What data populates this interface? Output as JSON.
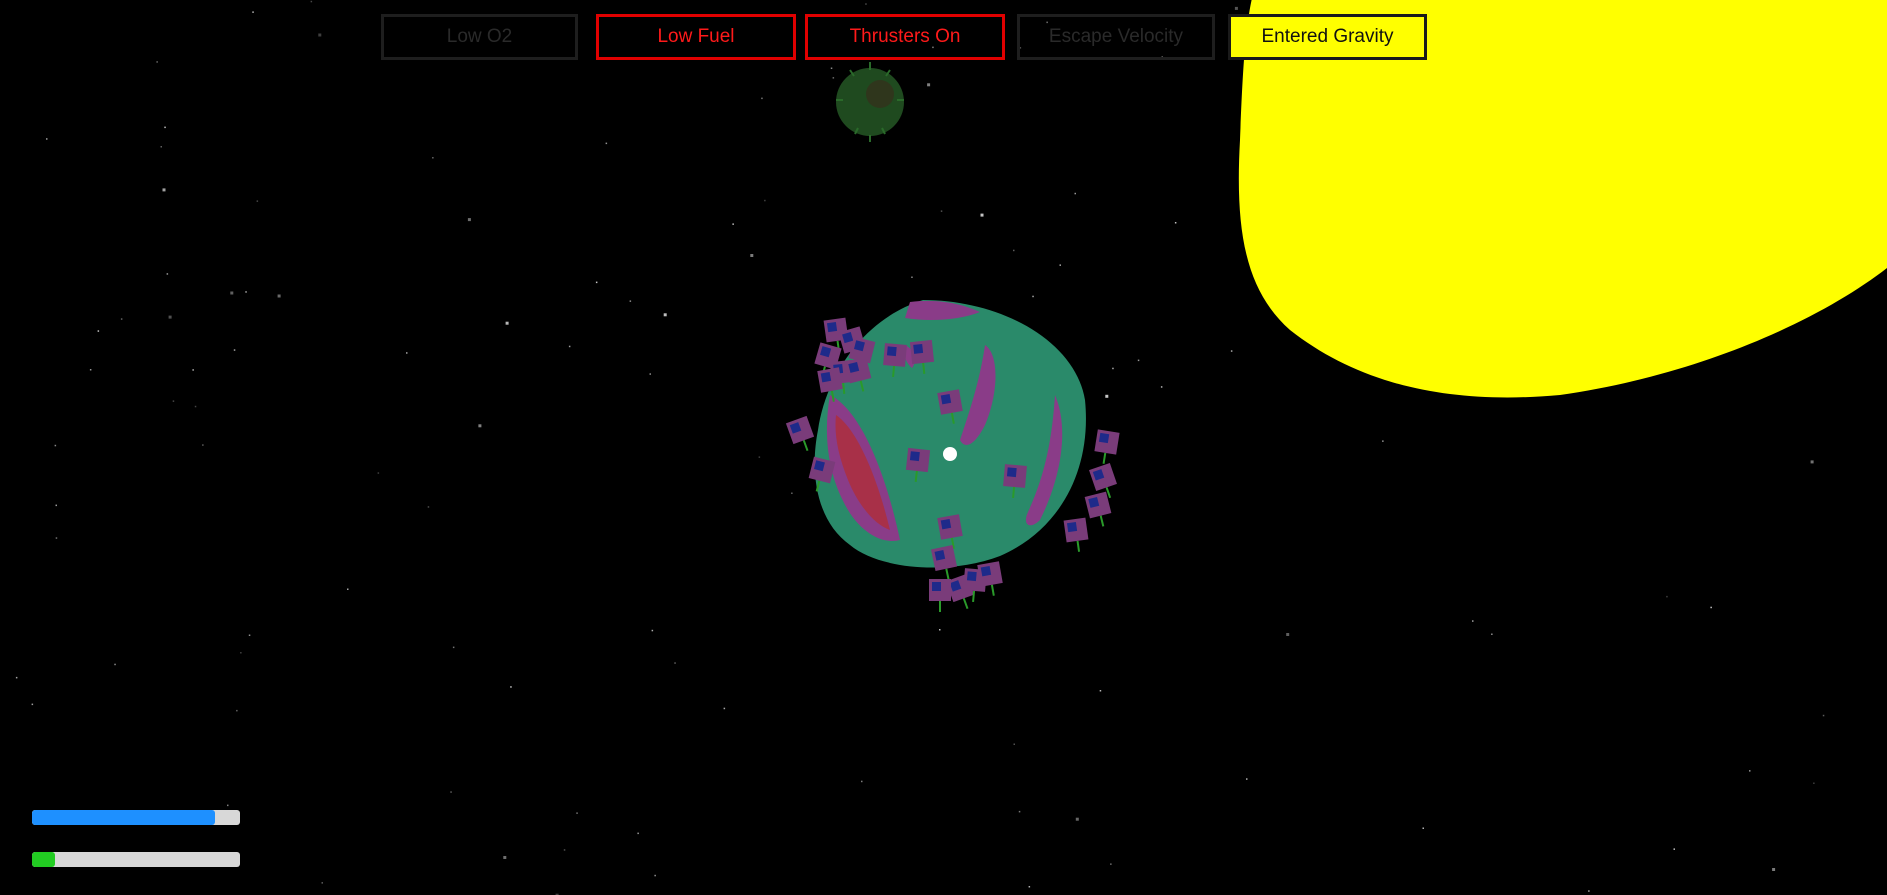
{
  "hud": {
    "status_indicators": [
      {
        "label": "Low O2",
        "active": false,
        "text_color": "#2a2a2a",
        "border_color": "#1e1e1e",
        "bg_color": "transparent"
      },
      {
        "label": "Low Fuel",
        "active": true,
        "text_color": "#ff1a1a",
        "border_color": "#e00000",
        "bg_color": "transparent"
      },
      {
        "label": "Thrusters On",
        "active": true,
        "text_color": "#ff1a1a",
        "border_color": "#e00000",
        "bg_color": "transparent"
      },
      {
        "label": "Escape Velocity",
        "active": false,
        "text_color": "#2a2a2a",
        "border_color": "#1e1e1e",
        "bg_color": "transparent"
      },
      {
        "label": "Entered Gravity",
        "active": true,
        "text_color": "#111111",
        "border_color": "#1a1a1a",
        "bg_color": "#ffff00"
      }
    ],
    "bars": [
      {
        "name": "oxygen",
        "fraction": 0.88,
        "color": "#1e90ff",
        "track_color": "#d8d8d8"
      },
      {
        "name": "fuel",
        "fraction": 0.11,
        "color": "#22cc22",
        "track_color": "#d8d8d8"
      }
    ]
  },
  "scene": {
    "background_color": "#000000",
    "sun_color": "#ffff00",
    "planet_colors": {
      "surface": "#2a8a6a",
      "band": "#8a3c88",
      "lowland": "#a83048"
    },
    "moon_color": "#1f4a1f",
    "crosshair_color": "#ffffff"
  }
}
